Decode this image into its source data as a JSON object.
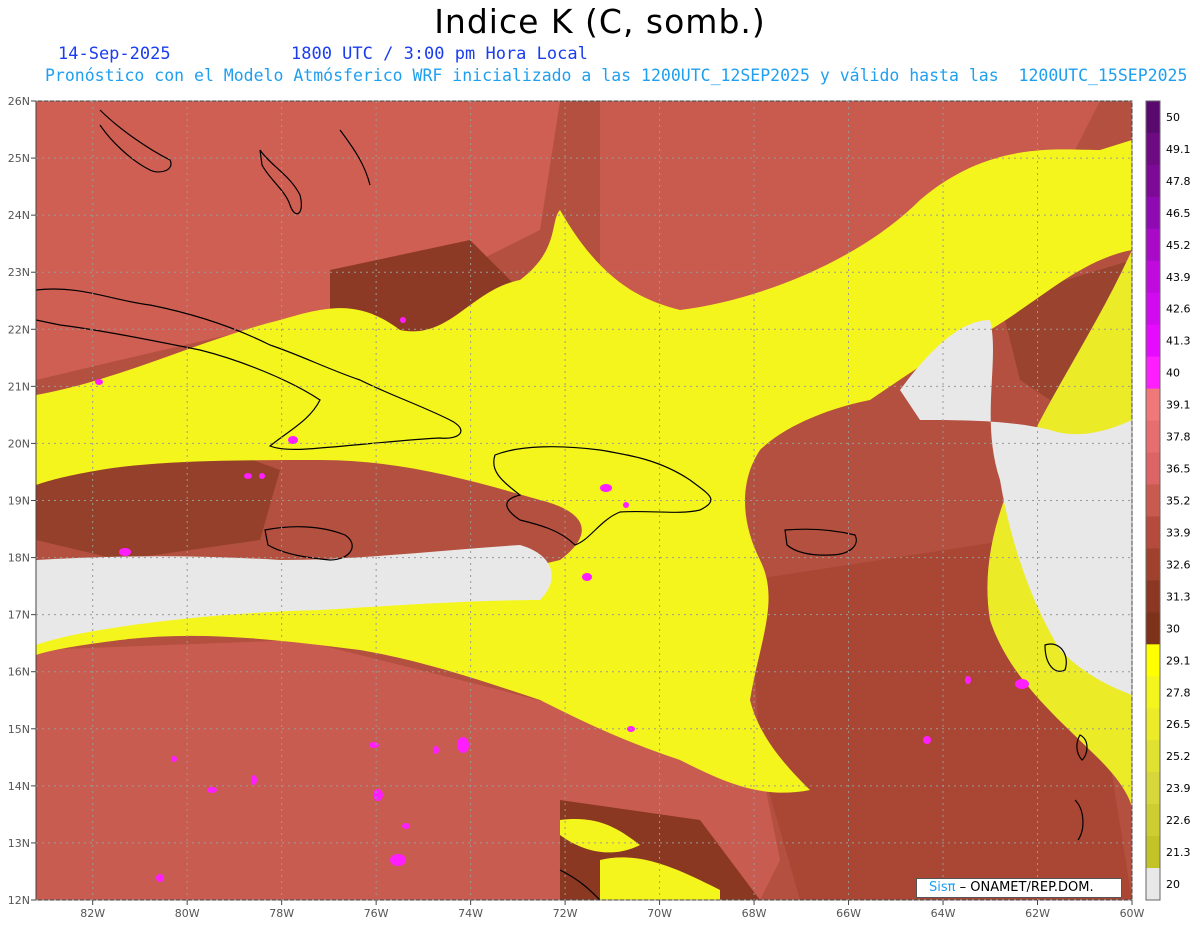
{
  "title": "Indice K (C, somb.)",
  "date": "14-Sep-2025",
  "time_label": "1800 UTC / 3:00 pm Hora Local",
  "description": "Pronóstico con el Modelo Atmósferico WRF inicializado a las 1200UTC_12SEP2025 y válido hasta las  1200UTC_15SEP2025",
  "credit": {
    "sis": "Sisπ",
    "org": " ONAMET/REP.DOM."
  },
  "map": {
    "lat_labels": [
      "26N",
      "25N",
      "24N",
      "23N",
      "22N",
      "21N",
      "20N",
      "19N",
      "18N",
      "17N",
      "16N",
      "15N",
      "14N",
      "13N",
      "12N"
    ],
    "lon_labels": [
      "82W",
      "80W",
      "78W",
      "76W",
      "74W",
      "72W",
      "70W",
      "68W",
      "66W",
      "64W",
      "62W",
      "60W"
    ],
    "lat_range": [
      12,
      26
    ],
    "lon_range": [
      -83.2,
      -60
    ],
    "gridlines": "dotted"
  },
  "legend": {
    "levels": [
      "50",
      "49.1",
      "47.8",
      "46.5",
      "45.2",
      "43.9",
      "42.6",
      "41.3",
      "40",
      "39.1",
      "37.8",
      "36.5",
      "35.2",
      "33.9",
      "32.6",
      "31.3",
      "30",
      "29.1",
      "27.8",
      "26.5",
      "25.2",
      "23.9",
      "22.6",
      "21.3",
      "20"
    ],
    "colors": [
      "#5a0a6e",
      "#6e0a82",
      "#7d0a96",
      "#900ab4",
      "#a80ac8",
      "#c00ade",
      "#d20af0",
      "#e60aff",
      "#ff1eff",
      "#f07878",
      "#e66e6e",
      "#dc6464",
      "#c85a50",
      "#b44b3c",
      "#a0412d",
      "#8c3723",
      "#7d3219",
      "#ffff00",
      "#f5f51e",
      "#ebeb28",
      "#e1e132",
      "#d7d73c",
      "#cdcd32",
      "#c3c328",
      "#e8e8e8"
    ]
  }
}
